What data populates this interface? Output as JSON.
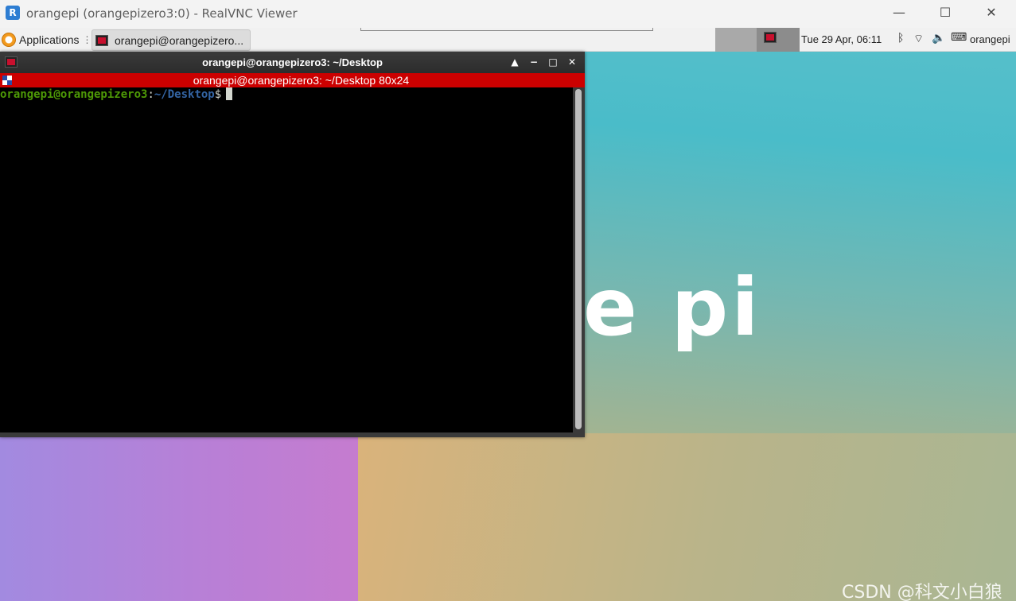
{
  "window": {
    "title": "orangepi (orangepizero3:0) - RealVNC Viewer",
    "logo_glyph": "R",
    "controls": {
      "minimize": "—",
      "maximize": "☐",
      "close": "✕"
    }
  },
  "panel": {
    "applications_label": "Applications",
    "applications_sep": "⋮",
    "task_button_label": "orangepi@orangepizero...",
    "clock": "Tue 29 Apr, 06:11",
    "tray": {
      "bluetooth": "ᛒ",
      "wifi": "⌔",
      "volume": "🔈",
      "keyboard": "⌨"
    },
    "user": "orangepi"
  },
  "terminal": {
    "title": "orangepi@orangepizero3: ~/Desktop",
    "size_banner": "orangepi@orangepizero3: ~/Desktop 80x24",
    "controls": {
      "up": "▲",
      "minimize": "−",
      "maximize": "□",
      "close": "✕"
    },
    "prompt": {
      "user_host": "orangepi@orangepizero3",
      "sep": ":",
      "path": "~/Desktop",
      "sign": "$"
    }
  },
  "wallpaper": {
    "logo_text": "e pi"
  },
  "watermark": "CSDN @科文小白狼",
  "colors": {
    "term_banner": "#cc0000",
    "prompt_user": "#4e9a06",
    "prompt_path": "#3465a4",
    "accent_orange": "#f29a1e"
  }
}
